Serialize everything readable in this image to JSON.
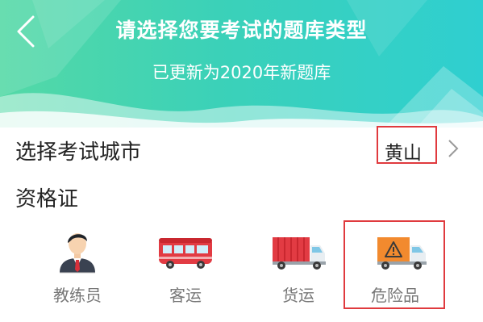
{
  "header": {
    "title": "请选择您要考试的题库类型",
    "subtitle": "已更新为2020年新题库",
    "back_icon": "chevron-left-icon",
    "gradient_colors": [
      "#54d9a6",
      "#2fcfd0"
    ]
  },
  "city": {
    "label": "选择考试城市",
    "value": "黄山",
    "chevron_icon": "chevron-right-icon"
  },
  "certificate": {
    "label": "资格证",
    "items": [
      {
        "label": "教练员",
        "icon": "instructor-icon"
      },
      {
        "label": "客运",
        "icon": "bus-icon"
      },
      {
        "label": "货运",
        "icon": "truck-icon"
      },
      {
        "label": "危险品",
        "icon": "hazmat-truck-icon"
      }
    ]
  },
  "colors": {
    "highlight_box": "#e03a3e",
    "label_gray": "#777777",
    "text_dark": "#222222"
  }
}
